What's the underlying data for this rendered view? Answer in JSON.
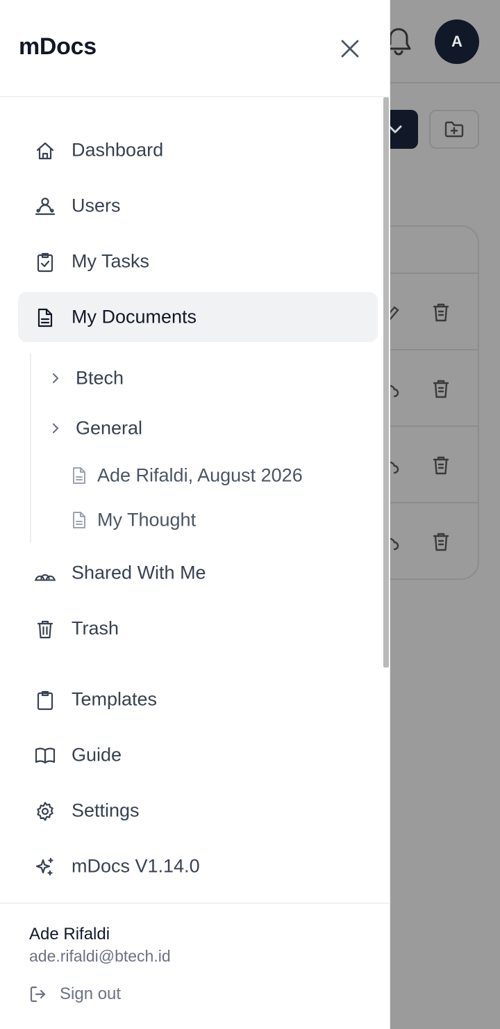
{
  "app": {
    "title": "mDocs"
  },
  "background": {
    "avatar_initial": "A"
  },
  "nav": {
    "dashboard": "Dashboard",
    "users": "Users",
    "my_tasks": "My Tasks",
    "my_documents": "My Documents",
    "shared_with_me": "Shared With Me",
    "trash": "Trash",
    "templates": "Templates",
    "guide": "Guide",
    "settings": "Settings",
    "version": "mDocs V1.14.0"
  },
  "documents_tree": {
    "folders": [
      "Btech",
      "General"
    ],
    "files": [
      "Ade Rifaldi, August 2026",
      "My Thought"
    ]
  },
  "user": {
    "name": "Ade Rifaldi",
    "email": "ade.rifaldi@btech.id",
    "sign_out": "Sign out"
  },
  "colors": {
    "overlay": "#9b9b9b",
    "active_bg": "#f1f2f4",
    "text_primary": "#111827",
    "text_secondary": "#374151",
    "text_muted": "#6b7280"
  }
}
